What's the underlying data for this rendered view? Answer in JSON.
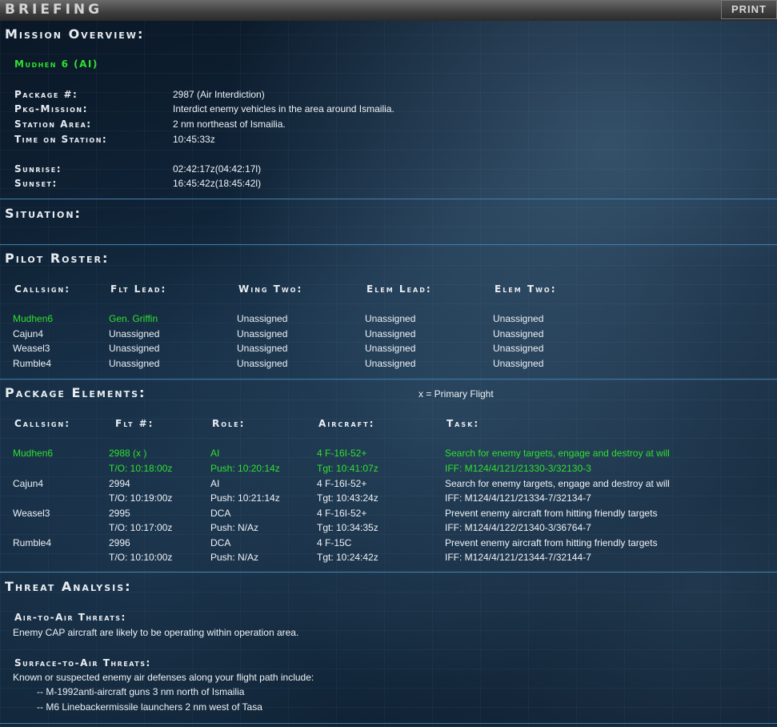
{
  "title": "BRIEFING",
  "print_label": "PRINT",
  "overview": {
    "heading": "Mission Overview:",
    "flight": "Mudhen 6 (AI)",
    "rows": [
      {
        "label": "Package #:",
        "value": "2987 (Air Interdiction)"
      },
      {
        "label": "Pkg-Mission:",
        "value": "Interdict enemy vehicles in the area around Ismailia."
      },
      {
        "label": "Station Area:",
        "value": "2 nm northeast of Ismailia."
      },
      {
        "label": "Time on Station:",
        "value": "10:45:33z"
      },
      {
        "label": "Sunrise:",
        "value": "02:42:17z(04:42:17l)"
      },
      {
        "label": "Sunset:",
        "value": "16:45:42z(18:45:42l)"
      }
    ]
  },
  "situation": {
    "heading": "Situation:"
  },
  "roster": {
    "heading": "Pilot Roster:",
    "columns": [
      "Callsign:",
      "Flt Lead:",
      "Wing Two:",
      "Elem Lead:",
      "Elem Two:"
    ],
    "rows": [
      [
        "Mudhen6",
        "Gen. Griffin",
        "Unassigned",
        "Unassigned",
        "Unassigned"
      ],
      [
        "Cajun4",
        "Unassigned",
        "Unassigned",
        "Unassigned",
        "Unassigned"
      ],
      [
        "Weasel3",
        "Unassigned",
        "Unassigned",
        "Unassigned",
        "Unassigned"
      ],
      [
        "Rumble4",
        "Unassigned",
        "Unassigned",
        "Unassigned",
        "Unassigned"
      ]
    ]
  },
  "package": {
    "heading": "Package Elements:",
    "legend": "x  = Primary Flight",
    "columns": [
      "Callsign:",
      "Flt #:",
      "Role:",
      "Aircraft:",
      "Task:"
    ],
    "rows": [
      {
        "callsign": "Mudhen6",
        "flt": "2988 (x )",
        "role": "AI",
        "aircraft": "4 F-16I-52+",
        "task": "Search for enemy targets, engage and destroy at will",
        "to": "T/O: 10:18:00z",
        "push": "Push: 10:20:14z",
        "tgt": "Tgt: 10:41:07z",
        "iff": "IFF: M124/4/121/21330-3/32130-3"
      },
      {
        "callsign": "Cajun4",
        "flt": "2994",
        "role": "AI",
        "aircraft": "4 F-16I-52+",
        "task": "Search for enemy targets, engage and destroy at will",
        "to": "T/O: 10:19:00z",
        "push": "Push: 10:21:14z",
        "tgt": "Tgt: 10:43:24z",
        "iff": "IFF: M124/4/121/21334-7/32134-7"
      },
      {
        "callsign": "Weasel3",
        "flt": "2995",
        "role": "DCA",
        "aircraft": "4 F-16I-52+",
        "task": "Prevent enemy aircraft from hitting friendly targets",
        "to": "T/O: 10:17:00z",
        "push": "Push: N/Az",
        "tgt": "Tgt: 10:34:35z",
        "iff": "IFF: M124/4/122/21340-3/36764-7"
      },
      {
        "callsign": "Rumble4",
        "flt": "2996",
        "role": "DCA",
        "aircraft": "4 F-15C",
        "task": "Prevent enemy aircraft from hitting friendly targets",
        "to": "T/O: 10:10:00z",
        "push": "Push: N/Az",
        "tgt": "Tgt: 10:24:42z",
        "iff": "IFF: M124/4/121/21344-7/32144-7"
      }
    ]
  },
  "threat": {
    "heading": "Threat Analysis:",
    "air_label": "Air-to-Air Threats:",
    "air_text": "Enemy CAP aircraft are likely to be operating within operation area.",
    "sam_label": "Surface-to-Air Threats:",
    "sam_text": "Known or suspected enemy air defenses along your flight path include:",
    "sam_items": [
      "-- M-1992anti-aircraft guns 3 nm north of Ismailia",
      "-- M6 Linebackermissile launchers 2 nm west of Tasa"
    ]
  },
  "colors": {
    "highlight": "#2fe02f",
    "separator": "#3f7fae"
  }
}
